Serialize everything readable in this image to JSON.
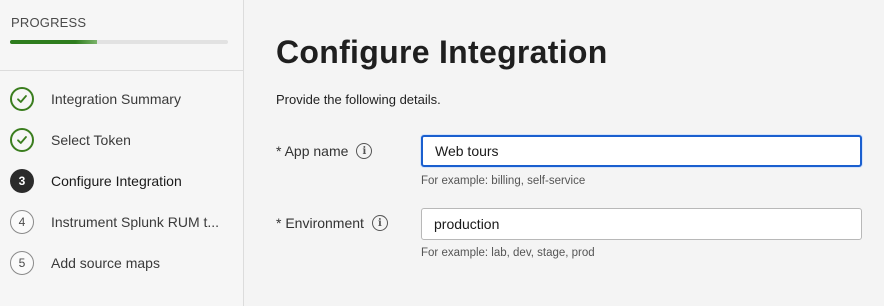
{
  "sidebar": {
    "progress_label": "PROGRESS",
    "progress_fraction": 0.4,
    "steps": [
      {
        "label": "Integration Summary",
        "status": "done",
        "marker": ""
      },
      {
        "label": "Select Token",
        "status": "done",
        "marker": ""
      },
      {
        "label": "Configure Integration",
        "status": "current",
        "marker": "3"
      },
      {
        "label": "Instrument Splunk RUM t...",
        "status": "todo",
        "marker": "4"
      },
      {
        "label": "Add source maps",
        "status": "todo",
        "marker": "5"
      }
    ]
  },
  "main": {
    "title": "Configure Integration",
    "subtitle": "Provide the following details.",
    "fields": {
      "app_name": {
        "label": "* App name",
        "value": "Web tours",
        "help": "For example: billing, self-service"
      },
      "environment": {
        "label": "* Environment",
        "value": "production",
        "help": "For example: lab, dev, stage, prod"
      }
    }
  },
  "colors": {
    "progress_green": "#2e7d1e",
    "focus_blue": "#1a5fcf",
    "current_step": "#2b2b2b"
  },
  "icons": {
    "done": "check-circle-icon",
    "info": "info-icon"
  }
}
